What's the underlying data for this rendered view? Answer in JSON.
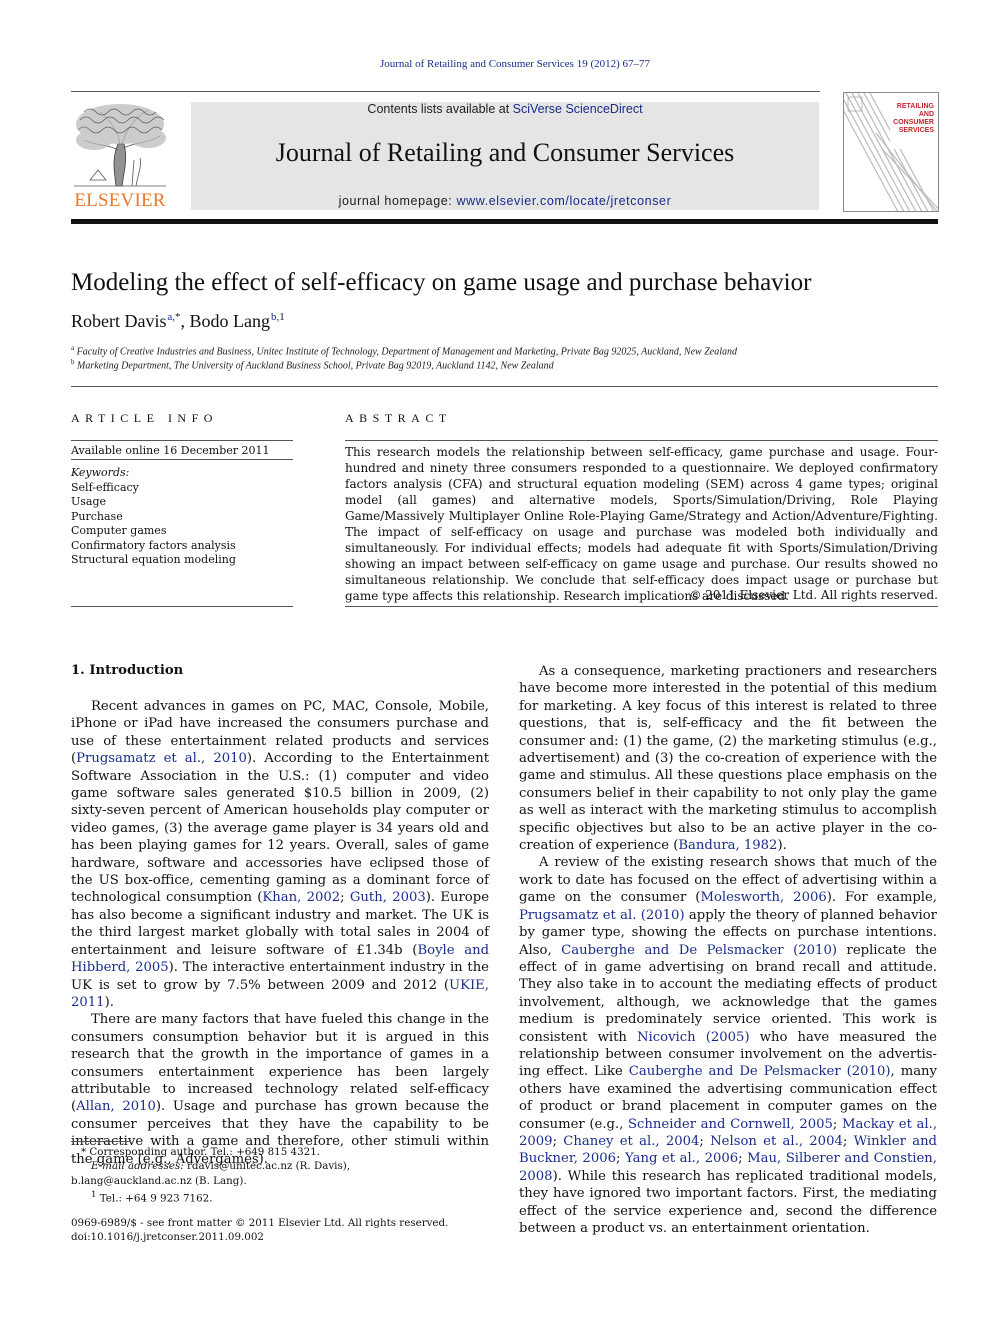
{
  "header": {
    "citation": "Journal of Retailing and Consumer Services 19 (2012) 67–77",
    "publisher_logo_text": "ELSEVIER",
    "contents_prefix": "Contents lists available at ",
    "contents_link": "SciVerse ScienceDirect",
    "journal_name": "Journal of Retailing and Consumer Services",
    "homepage_prefix": "journal homepage: ",
    "homepage_link": "www.elsevier.com/locate/jretconser",
    "cover_lines": [
      "RETAILING",
      "AND",
      "CONSUMER",
      "SERVICES"
    ]
  },
  "article": {
    "title": "Modeling the effect of self-efficacy on game usage and purchase behavior",
    "authors": [
      {
        "name": "Robert Davis",
        "sup_link": "a,",
        "sup_mark": "*"
      },
      {
        "name": "Bodo Lang",
        "sup_link": "b,",
        "sup_mark": "1"
      }
    ],
    "author_separator": ", ",
    "affiliations": [
      {
        "mark": "a",
        "text": "Faculty of Creative Industries and Business, Unitec Institute of Technology, Department of Management and Marketing, Private Bag 92025, Auckland, New Zealand"
      },
      {
        "mark": "b",
        "text": "Marketing Department, The University of Auckland Business School, Private Bag 92019, Auckland 1142, New Zealand"
      }
    ]
  },
  "article_info": {
    "heading": "ARTICLE INFO",
    "available_online": "Available online 16 December 2011",
    "keywords_label": "Keywords:",
    "keywords": [
      "Self-efficacy",
      "Usage",
      "Purchase",
      "Computer games",
      "Confirmatory factors analysis",
      "Structural equation modeling"
    ]
  },
  "abstract": {
    "heading": "ABSTRACT",
    "text": "This research models the relationship between self-efficacy, game purchase and usage. Four-hundred and ninety three consumers responded to a questionnaire. We deployed confirmatory factors analysis (CFA) and structural equation modeling (SEM) across 4 game types; original model (all games) and alternative models, Sports/Simulation/Driving, Role Playing Game/Massively Multiplayer Online Role-Playing Game/Strategy and Action/Adventure/Fighting. The impact of self-efficacy on usage and purchase was modeled both individually and simultaneously. For individual effects; models had adequate fit with Sports/Simulation/Driving showing an impact between self-efficacy on game usage and purchase. Our results showed no simultaneous relationship. We conclude that self-efficacy does impact usage or purchase but game type affects this relationship. Research implications are discussed.",
    "copyright": "© 2011 Elsevier Ltd. All rights reserved."
  },
  "body": {
    "section_heading": "1.  Introduction",
    "paragraphs": [
      [
        {
          "t": "Recent advances in games on PC, MAC, Console, Mobile, iPhone or iPad have increased the consumers purchase and use of these entertainment related products and services ("
        },
        {
          "t": "Prugsamatz et al., 2010",
          "link": true
        },
        {
          "t": "). According to the Entertainment Software Association in the U.S.: (1) computer and video game software sales generated $10.5 billion in 2009, (2) sixty-seven percent of American house­holds play computer or video games, (3) the average game player is 34 years old and has been playing games for 12 years. Overall, sales of game hardware, software and accessories have eclipsed those of the US box-office, cementing gaming as a dominant force of technological consumption ("
        },
        {
          "t": "Khan, 2002",
          "link": true
        },
        {
          "t": "; "
        },
        {
          "t": "Guth, 2003",
          "link": true
        },
        {
          "t": "). Europe has also become a significant industry and market. The UK is the third largest market globally with total sales in 2004 of entertain­ment and leisure software of £1.34b ("
        },
        {
          "t": "Boyle and Hibberd, 2005",
          "link": true
        },
        {
          "t": "). The interactive entertainment industry in the UK is set to grow by 7.5% between 2009 and 2012 ("
        },
        {
          "t": "UKIE, 2011",
          "link": true
        },
        {
          "t": ")."
        }
      ],
      [
        {
          "t": "There are many factors that have fueled this change in the consumers consumption behavior but it is argued in this research that the growth in the importance of games in a consumers enter­tainment experience has been largely attributable to increased technology related self-efficacy ("
        },
        {
          "t": "Allan, 2010",
          "link": true
        },
        {
          "t": "). Usage and purchase has grown because the consumer perceives that they have the capability to be interactive with a game and therefore, other stimuli within the game (e.g., Advergames)."
        }
      ],
      [
        {
          "t": "As a consequence, marketing practioners and researchers have become more interested in the potential of this medium for market­ing. A key focus of this interest is related to three questions, that is, self-efficacy and the fit between the consumer and: (1) the game, (2) the marketing stimulus (e.g., advertisement) and (3) the co-creation of experience with the game and stimulus. All these questions place emphasis on the consumers belief in their capability to not only play the game as well as interact with the marketing stimulus to accomplish specific objectives but also to be an active player in the co-creation of experience ("
        },
        {
          "t": "Bandura, 1982",
          "link": true
        },
        {
          "t": ")."
        }
      ],
      [
        {
          "t": "A review of the existing research shows that much of the work to date has focused on the effect of advertising within a game on the consumer ("
        },
        {
          "t": "Molesworth, 2006",
          "link": true
        },
        {
          "t": "). For example, "
        },
        {
          "t": "Prugsamatz et al. (2010)",
          "link": true
        },
        {
          "t": " apply the theory of planned behavior by gamer type, showing the effects on purchase intentions. Also, "
        },
        {
          "t": "Cauberghe and De Pelsmacker (2010)",
          "link": true
        },
        {
          "t": " replicate the effect of in game advertising on brand recall and attitude. They also take in to account the mediating effects of product involvement, although, we acknowl­edge that the games medium is predominately service oriented. This work is consistent with "
        },
        {
          "t": "Nicovich (2005)",
          "link": true
        },
        {
          "t": " who have measured the relationship between consumer involvement on the advertis­ing effect. Like "
        },
        {
          "t": "Cauberghe and De Pelsmacker (2010)",
          "link": true
        },
        {
          "t": ", many others have examined the advertising communication effect of product or brand placement in computer games on the consumer (e.g., "
        },
        {
          "t": "Schneider and Cornwell, 2005",
          "link": true
        },
        {
          "t": "; "
        },
        {
          "t": "Mackay et al., 2009",
          "link": true
        },
        {
          "t": "; "
        },
        {
          "t": "Chaney et al., 2004",
          "link": true
        },
        {
          "t": "; "
        },
        {
          "t": "Nelson et al., 2004",
          "link": true
        },
        {
          "t": "; "
        },
        {
          "t": "Winkler and Buckner, 2006",
          "link": true
        },
        {
          "t": "; "
        },
        {
          "t": "Yang et al., 2006",
          "link": true
        },
        {
          "t": "; "
        },
        {
          "t": "Mau, Silberer and Constien, 2008",
          "link": true
        },
        {
          "t": "). While this research has replicated traditional models, they have ignored two important factors. First, the mediating effect of the service experience and, second the difference between a product vs. an entertainment orientation."
        }
      ]
    ]
  },
  "footnotes": {
    "corresponding": "* Corresponding author. Tel.: +649 815 4321.",
    "email_label": "E-mail addresses:",
    "email_1": " rdavis@unitec.ac.nz (R. Davis),",
    "email_2": "b.lang@auckland.ac.nz (B. Lang).",
    "note_1_mark": "1",
    "note_1": " Tel.: +64 9 923 7162.",
    "front_matter": "0969-6989/$ - see front matter © 2011 Elsevier Ltd. All rights reserved.",
    "doi": "doi:10.1016/j.jretconser.2011.09.002"
  },
  "colors": {
    "link": "#1a2c8a",
    "elsevier_orange": "#e8792b",
    "banner_gray": "#e5e5e5",
    "cover_red": "#c0272d"
  }
}
